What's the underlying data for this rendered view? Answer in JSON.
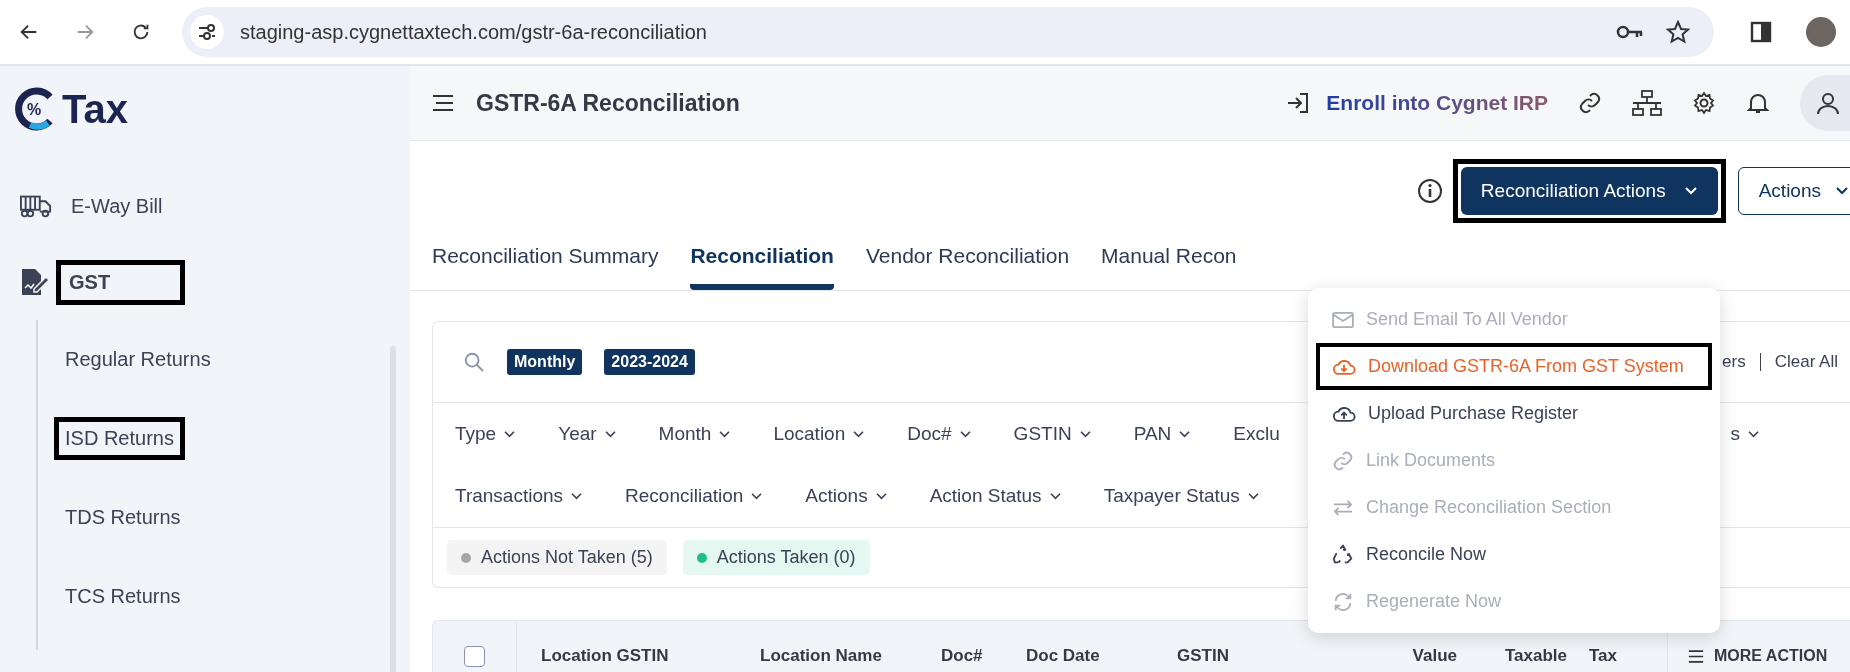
{
  "browser": {
    "url": "staging-asp.cygnettaxtech.com/gstr-6a-reconciliation"
  },
  "logo": {
    "mark": "%",
    "text": "Tax"
  },
  "sidebar": {
    "items": [
      {
        "label": "E-Way Bill",
        "highlighted": false
      },
      {
        "label": "GST",
        "highlighted": true,
        "children": [
          {
            "label": "Regular Returns",
            "highlighted": false
          },
          {
            "label": "ISD Returns",
            "highlighted": true
          },
          {
            "label": "TDS Returns",
            "highlighted": false
          },
          {
            "label": "TCS Returns",
            "highlighted": false
          }
        ]
      }
    ]
  },
  "header": {
    "title": "GSTR-6A Reconciliation",
    "enroll": "Enroll into Cygnet IRP"
  },
  "toolbar": {
    "primary": {
      "label": "Reconciliation Actions",
      "highlighted": true
    },
    "secondary": {
      "label": "Actions"
    }
  },
  "tabs": [
    {
      "label": "Reconciliation Summary",
      "selected": false
    },
    {
      "label": "Reconciliation",
      "selected": true
    },
    {
      "label": "Vendor Reconciliation",
      "selected": false
    },
    {
      "label": "Manual Recon",
      "selected": false
    }
  ],
  "menu": {
    "items": [
      {
        "label": "Send Email To All Vendor",
        "disabled": true,
        "active": false,
        "highlighted": false
      },
      {
        "label": "Download GSTR-6A From GST System",
        "disabled": false,
        "active": true,
        "highlighted": true
      },
      {
        "label": "Upload Purchase Register",
        "disabled": false,
        "active": false,
        "highlighted": false
      },
      {
        "label": "Link Documents",
        "disabled": true,
        "active": false,
        "highlighted": false
      },
      {
        "label": "Change Reconciliation Section",
        "disabled": true,
        "active": false,
        "highlighted": false
      },
      {
        "label": "Reconcile Now",
        "disabled": false,
        "active": false,
        "highlighted": false
      },
      {
        "label": "Regenerate Now",
        "disabled": true,
        "active": false,
        "highlighted": false
      }
    ]
  },
  "search": {
    "chips": [
      "Monthly",
      "2023-2024"
    ],
    "links": [
      "ers",
      "Clear All"
    ]
  },
  "filters": {
    "first_line": [
      {
        "label": "Type",
        "dropdown": true
      },
      {
        "label": "Year",
        "dropdown": true
      },
      {
        "label": "Month",
        "dropdown": true
      },
      {
        "label": "Location",
        "dropdown": true
      },
      {
        "label": "Doc#",
        "dropdown": true
      },
      {
        "label": "GSTIN",
        "dropdown": true
      },
      {
        "label": "PAN",
        "dropdown": true
      },
      {
        "label": "Exclu",
        "dropdown": false
      }
    ],
    "second_line": [
      {
        "label": "Transactions",
        "dropdown": true
      },
      {
        "label": "Reconciliation",
        "dropdown": true
      },
      {
        "label": "Actions",
        "dropdown": true
      },
      {
        "label": "Action Status",
        "dropdown": true
      },
      {
        "label": "Taxpayer Status",
        "dropdown": true
      }
    ],
    "trailing": {
      "label": "s",
      "dropdown": true
    }
  },
  "status_pills": [
    {
      "label": "Actions Not Taken (5)",
      "color": "#a6a6a6"
    },
    {
      "label": "Actions Taken (0)",
      "color": "#1dbf8a"
    }
  ],
  "table": {
    "select_all": false,
    "columns": [
      "Location GSTIN",
      "Location Name",
      "Doc#",
      "Doc Date",
      "GSTIN",
      "Value",
      "Taxable",
      "Tax"
    ],
    "more_action": "MORE ACTION"
  }
}
